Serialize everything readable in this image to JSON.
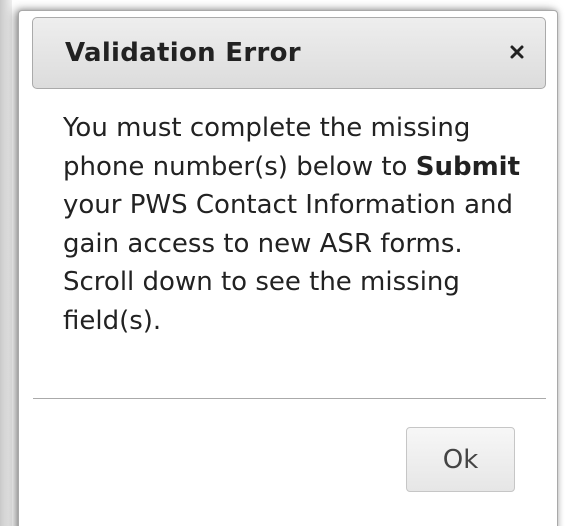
{
  "dialog": {
    "title": "Validation Error",
    "close_icon": "close-icon",
    "message": {
      "part1": "You must complete the missing phone number(s) below to ",
      "bold": "Submit",
      "part2": " your PWS Contact Information and gain access to new ASR forms. Scroll down to see the missing field(s)."
    },
    "ok_label": "Ok"
  },
  "colors": {
    "titlebar_top": "#eeeeee",
    "titlebar_bottom": "#dcdcdc",
    "text": "#222222",
    "border": "#aaaaaa"
  }
}
